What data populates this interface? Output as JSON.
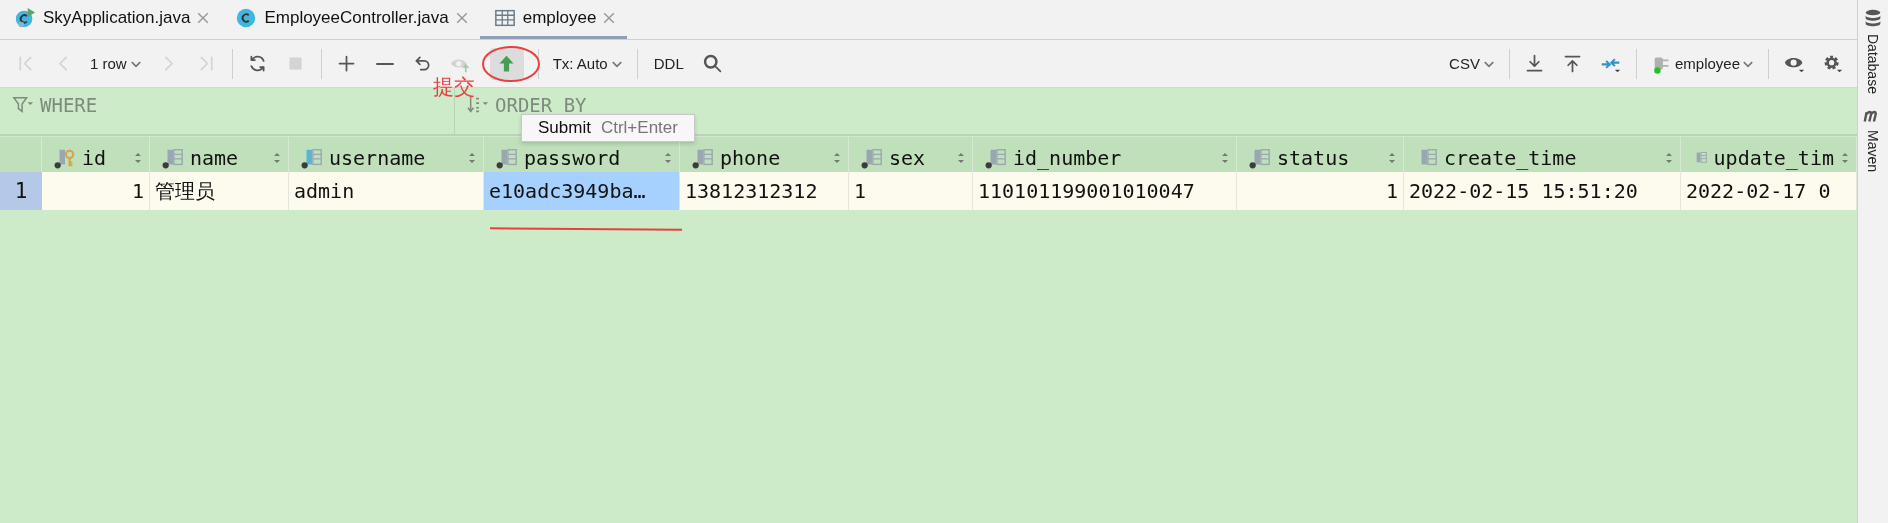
{
  "tabs": [
    {
      "label": "SkyApplication.java",
      "kind": "runnable",
      "selected": false
    },
    {
      "label": "EmployeeController.java",
      "kind": "class",
      "selected": false
    },
    {
      "label": "employee",
      "kind": "table",
      "selected": true
    }
  ],
  "toolbar": [
    {
      "kind": "first",
      "disabled": true
    },
    {
      "kind": "prev",
      "disabled": true
    },
    {
      "kind": "dropdown",
      "label": "1 row",
      "disabled": false
    },
    {
      "kind": "next",
      "disabled": true
    },
    {
      "kind": "last",
      "disabled": true
    },
    {
      "kind": "separator"
    },
    {
      "kind": "refresh",
      "disabled": false
    },
    {
      "kind": "stop",
      "disabled": true
    },
    {
      "kind": "separator"
    },
    {
      "kind": "plus",
      "disabled": false
    },
    {
      "kind": "minus",
      "disabled": false
    },
    {
      "kind": "undo",
      "disabled": false
    },
    {
      "kind": "preview",
      "disabled": true
    },
    {
      "kind": "submit",
      "disabled": false,
      "highlighted": true
    },
    {
      "kind": "separator"
    },
    {
      "kind": "dropdown",
      "label": "Tx: Auto",
      "disabled": false
    },
    {
      "kind": "separator"
    },
    {
      "kind": "text",
      "label": "DDL",
      "disabled": false
    },
    {
      "kind": "search",
      "disabled": false
    },
    {
      "kind": "spacer"
    },
    {
      "kind": "dropdown",
      "label": "CSV",
      "disabled": false
    },
    {
      "kind": "separator"
    },
    {
      "kind": "download",
      "disabled": false
    },
    {
      "kind": "upload",
      "disabled": false
    },
    {
      "kind": "compare",
      "disabled": false
    },
    {
      "kind": "separator"
    },
    {
      "kind": "session",
      "label": "employee",
      "disabled": false
    },
    {
      "kind": "separator"
    },
    {
      "kind": "eye",
      "disabled": false
    },
    {
      "kind": "gear",
      "disabled": false
    }
  ],
  "filter": {
    "where": "WHERE",
    "order_by": "ORDER BY"
  },
  "tooltip": {
    "label": "Submit",
    "shortcut": "Ctrl+Enter"
  },
  "annotation": {
    "text": "提交"
  },
  "table": {
    "columns": [
      {
        "name": "id",
        "kind": "primary_key",
        "not_null": true,
        "numeric": true
      },
      {
        "name": "name",
        "kind": "plain",
        "not_null": true,
        "numeric": false
      },
      {
        "name": "username",
        "kind": "indexed",
        "not_null": true,
        "numeric": false
      },
      {
        "name": "password",
        "kind": "plain",
        "not_null": true,
        "numeric": false
      },
      {
        "name": "phone",
        "kind": "plain",
        "not_null": true,
        "numeric": false
      },
      {
        "name": "sex",
        "kind": "plain",
        "not_null": true,
        "numeric": false
      },
      {
        "name": "id_number",
        "kind": "plain",
        "not_null": true,
        "numeric": false
      },
      {
        "name": "status",
        "kind": "plain",
        "not_null": true,
        "numeric": true
      },
      {
        "name": "create_time",
        "kind": "plain",
        "not_null": false,
        "numeric": false
      },
      {
        "name": "update_tim",
        "kind": "plain",
        "not_null": false,
        "numeric": false
      }
    ],
    "rows": [
      {
        "number": "1",
        "cells": [
          {
            "value": "1",
            "selected": false
          },
          {
            "value": "管理员",
            "selected": false
          },
          {
            "value": "admin",
            "selected": false
          },
          {
            "value": "e10adc3949ba…",
            "selected": true
          },
          {
            "value": "13812312312",
            "selected": false
          },
          {
            "value": "1",
            "selected": false
          },
          {
            "value": "110101199001010047",
            "selected": false
          },
          {
            "value": "1",
            "selected": false
          },
          {
            "value": "2022-02-15 15:51:20",
            "selected": false
          },
          {
            "value": "2022-02-17 0",
            "selected": false
          }
        ]
      }
    ]
  },
  "side_panel": [
    {
      "label": "Database",
      "kind": "database"
    },
    {
      "label": "Maven",
      "kind": "maven"
    }
  ]
}
